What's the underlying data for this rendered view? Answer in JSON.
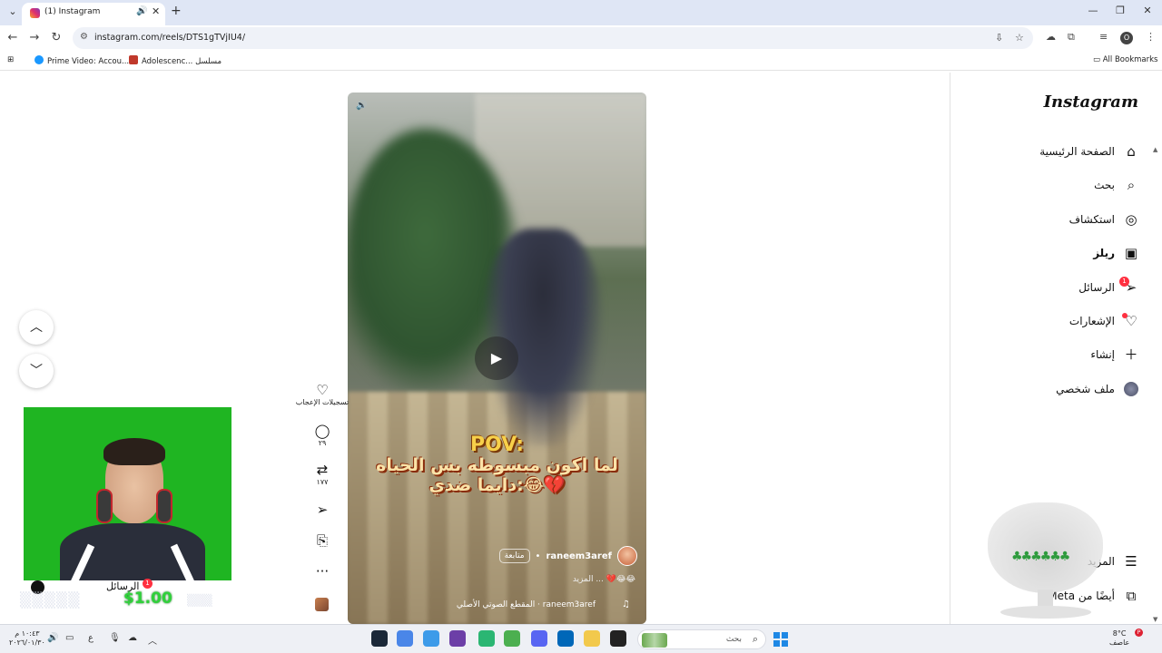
{
  "browser": {
    "tab_title": "(1) Instagram",
    "tab_audio_icon": "speaker-icon",
    "url": "instagram.com/reels/DTS1gTVjIU4/",
    "bookmarks": [
      {
        "label": "Prime Video: Accou..."
      },
      {
        "label": "Adolescenc... مسلسل"
      }
    ],
    "all_bookmarks": "All Bookmarks",
    "profile_initial": "O"
  },
  "sidebar": {
    "logo": "Instagram",
    "items": [
      {
        "label": "الصفحة الرئيسية",
        "icon": "home-icon"
      },
      {
        "label": "بحث",
        "icon": "search-icon"
      },
      {
        "label": "استكشاف",
        "icon": "explore-icon"
      },
      {
        "label": "ريلز",
        "icon": "reels-icon"
      },
      {
        "label": "الرسائل",
        "icon": "messages-icon",
        "badge": "1"
      },
      {
        "label": "الإشعارات",
        "icon": "heart-icon"
      },
      {
        "label": "إنشاء",
        "icon": "plus-icon"
      },
      {
        "label": "ملف شخصي",
        "icon": "avatar-icon"
      }
    ],
    "more": "المزيد",
    "also_from_meta": "أيضًا من Meta"
  },
  "reel": {
    "caption_pov": "POV:",
    "caption_line1": "لما اكون مبسوطه بس الحياه",
    "caption_line2": "دايما ضدي:😂💔",
    "author": "raneem3aref",
    "follow": "متابعة",
    "description": "😂😂💔 ... المزيد",
    "audio": "raneem3aref · المقطع الصوتي الأصلي"
  },
  "actions": {
    "likes_label": "تسجيلات الإعجاب",
    "comments_count": "٢٩",
    "reposts_count": "١٧٧"
  },
  "overlay": {
    "messages_label": "الرسائل",
    "messages_badge": "1",
    "donation": "$1.00"
  },
  "taskbar": {
    "time": "١٠:٤٣ م",
    "date": "٢٠٢٦/٠١/٣٠",
    "search_placeholder": "بحث",
    "temperature": "8°C",
    "weather": "عاصف",
    "weather_badge": "P"
  }
}
